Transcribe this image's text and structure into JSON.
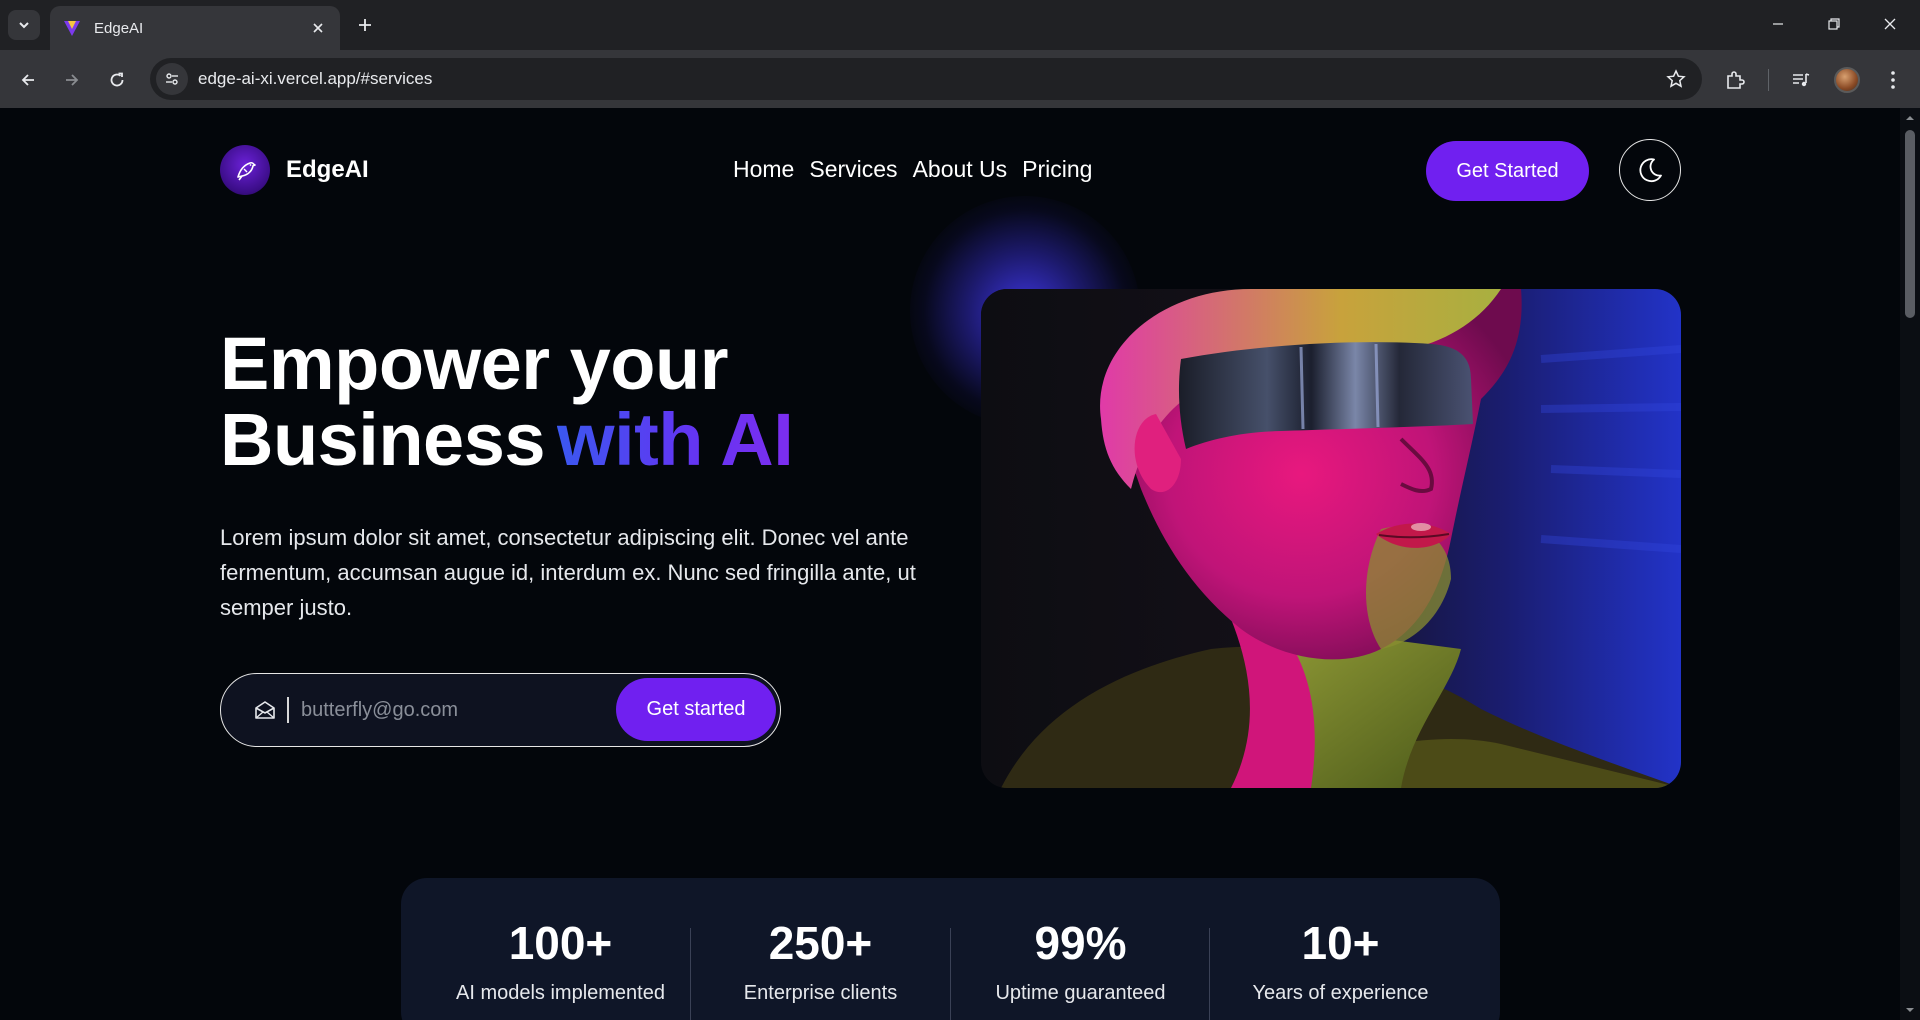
{
  "browser": {
    "tab_title": "EdgeAI",
    "url": "edge-ai-xi.vercel.app/#services"
  },
  "nav": {
    "brand": "EdgeAI",
    "links": [
      "Home",
      "Services",
      "About Us",
      "Pricing"
    ],
    "cta_label": "Get Started"
  },
  "hero": {
    "title_line1": "Empower your",
    "title_line2_plain": "Business",
    "title_line2_accent": "with AI",
    "description": "Lorem ipsum dolor sit amet, consectetur adipiscing elit. Donec vel ante fermentum, accumsan augue id, interdum ex. Nunc sed fringilla ante, ut semper justo.",
    "email_placeholder": "butterfly@go.com",
    "email_button": "Get started"
  },
  "stats": [
    {
      "value": "100+",
      "label": "AI models implemented"
    },
    {
      "value": "250+",
      "label": "Enterprise clients"
    },
    {
      "value": "99%",
      "label": "Uptime guaranteed"
    },
    {
      "value": "10+",
      "label": "Years of experience"
    }
  ],
  "colors": {
    "accent": "#7020f0",
    "page_bg": "#03060b",
    "stats_bg": "#0f1628"
  }
}
